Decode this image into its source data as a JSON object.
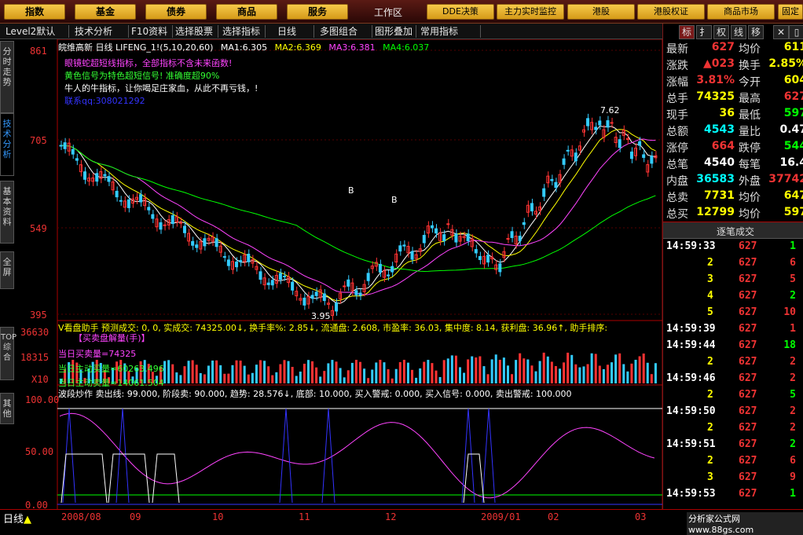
{
  "top_menu": {
    "left_buttons": [
      "指数",
      "基金",
      "债券",
      "商品",
      "服务"
    ],
    "workarea": "工作区",
    "right_buttons": [
      "DDE决策",
      "主力实时监控",
      "港股",
      "港股权证",
      "商品市场",
      "固定"
    ]
  },
  "toolbar": {
    "items": [
      "Level2默认",
      "技术分析",
      "F10资料",
      "选择股票",
      "选择指标",
      "日线",
      "多图组合",
      "图形叠加",
      "常用指标"
    ]
  },
  "side_tabs": [
    "分时走势",
    "技术分析",
    "基本资料",
    "全屏",
    "TOP综合",
    "其他"
  ],
  "main_chart": {
    "title_line": "皖维高新 日线 LIFENG_1!(5,10,20,60)",
    "ma": [
      {
        "label": "MA1:",
        "value": "6.305",
        "color": "#ffffff"
      },
      {
        "label": "MA2:",
        "value": "6.369",
        "color": "#ffff00"
      },
      {
        "label": "MA3:",
        "value": "6.381",
        "color": "#ff44ff"
      },
      {
        "label": "MA4:",
        "value": "6.037",
        "color": "#00ff00"
      }
    ],
    "notes": [
      {
        "text": "眼镜蛇超短线指标，全部指标不含未来函数!",
        "color": "#ff44ff"
      },
      {
        "text": "黄色信号为特色超短信号! 准确度超90%",
        "color": "#33ff33"
      },
      {
        "text": "牛人的牛指标，让你喝足庄家血，从此不再亏钱，!",
        "color": "#ffffff"
      },
      {
        "text": "联系qq:308021292",
        "color": "#3333ff"
      }
    ],
    "y_ticks": [
      "861",
      "705",
      "549",
      "395"
    ],
    "high_label": "7.62",
    "low_label": "3.95",
    "signal_labels": [
      "B",
      "B"
    ]
  },
  "volume_panel": {
    "header": "V看盘助手 预测成交: 0, 0, 实成交: 74325.00↓, 换手率%: 2.85↓, 流通盘: 2.608, 市盈率: 36.03, 集中度: 8.14, 获利盘: 36.96↑, 助手排序:",
    "sub": "【买卖盘解量(手)】",
    "lines": [
      "当日买卖量=74325",
      "当日主动买量=60263.496",
      "当日主动卖量=14061.504"
    ],
    "y_ticks": [
      "36630",
      "18315",
      "X10"
    ]
  },
  "osc_panel": {
    "header": "波段炒作 卖出线: 99.000, 阶段卖: 90.000, 趋势: 28.576↓, 底部: 10.000, 买入警戒: 0.000, 买入信号: 0.000, 卖出警戒: 100.000",
    "y_ticks": [
      "100.00",
      "50.00",
      "0.00"
    ]
  },
  "x_axis": [
    "日线",
    "2008/08",
    "09",
    "10",
    "11",
    "12",
    "2009/01",
    "02",
    "03"
  ],
  "quote": {
    "rows": [
      {
        "k1": "最新",
        "v1": "627",
        "k2": "均价",
        "v2": "611"
      },
      {
        "k1": "涨跌",
        "v1": "▲023",
        "k2": "换手",
        "v2": "2.85%"
      },
      {
        "k1": "涨幅",
        "v1": "3.81%",
        "k2": "今开",
        "v2": "604"
      },
      {
        "k1": "总手",
        "v1": "74325",
        "k2": "最高",
        "v2": "627"
      },
      {
        "k1": "现手",
        "v1": "36",
        "k2": "最低",
        "v2": "597"
      },
      {
        "k1": "总额",
        "v1": "4543",
        "k2": "量比",
        "v2": "0.47"
      },
      {
        "k1": "涨停",
        "v1": "664",
        "k2": "跌停",
        "v2": "544"
      },
      {
        "k1": "总笔",
        "v1": "4540",
        "k2": "每笔",
        "v2": "16.4"
      },
      {
        "k1": "内盘",
        "v1": "36583",
        "k2": "外盘",
        "v2": "37742"
      },
      {
        "k1": "总卖",
        "v1": "7731",
        "k2": "均价",
        "v2": "647"
      },
      {
        "k1": "总买",
        "v1": "12799",
        "k2": "均价",
        "v2": "597"
      }
    ],
    "tabs": [
      "标",
      "扌",
      "权",
      "线",
      "移"
    ]
  },
  "ticks": {
    "title": "逐笔成交",
    "rows": [
      {
        "time": "14:59:33",
        "vol": "",
        "price": "627",
        "num": "1"
      },
      {
        "time": "",
        "vol": "2",
        "price": "627",
        "num": "6"
      },
      {
        "time": "",
        "vol": "3",
        "price": "627",
        "num": "5"
      },
      {
        "time": "",
        "vol": "4",
        "price": "627",
        "num": "2"
      },
      {
        "time": "",
        "vol": "5",
        "price": "627",
        "num": "10"
      },
      {
        "time": "14:59:39",
        "vol": "",
        "price": "627",
        "num": "1"
      },
      {
        "time": "14:59:44",
        "vol": "",
        "price": "627",
        "num": "18"
      },
      {
        "time": "",
        "vol": "2",
        "price": "627",
        "num": "2"
      },
      {
        "time": "14:59:46",
        "vol": "",
        "price": "627",
        "num": "2"
      },
      {
        "time": "",
        "vol": "2",
        "price": "627",
        "num": "5"
      },
      {
        "time": "14:59:50",
        "vol": "",
        "price": "627",
        "num": "2"
      },
      {
        "time": "",
        "vol": "2",
        "price": "627",
        "num": "2"
      },
      {
        "time": "14:59:51",
        "vol": "",
        "price": "627",
        "num": "2"
      },
      {
        "time": "",
        "vol": "2",
        "price": "627",
        "num": "6"
      },
      {
        "time": "",
        "vol": "3",
        "price": "627",
        "num": "9"
      },
      {
        "time": "14:59:53",
        "vol": "",
        "price": "627",
        "num": "1"
      }
    ]
  },
  "footer": "分析家公式网 www.88gs.com"
}
